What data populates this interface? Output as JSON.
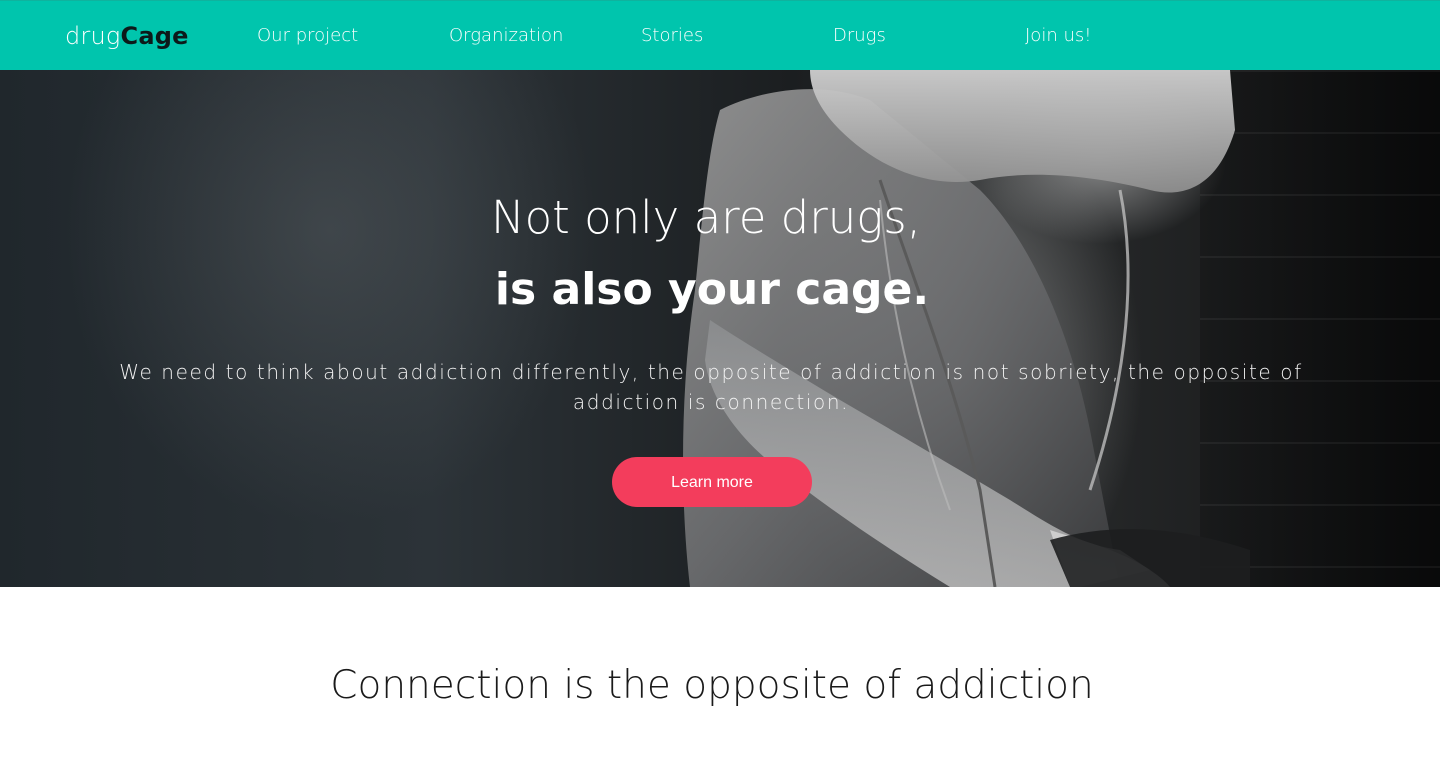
{
  "navbar": {
    "brand_light": "drug",
    "brand_bold": "Cage",
    "links": [
      "Our project",
      "Organization",
      "Stories",
      "Drugs",
      "Join us!"
    ],
    "background_color": "#00c5ad"
  },
  "hero": {
    "title_line1": "Not only are drugs,",
    "title_line2": "is also your cage.",
    "description": "We need to think about addiction differently, the opposite of addiction is not sobriety, the opposite of addiction is connection.",
    "button_label": "Learn more",
    "button_color": "#f33d5c",
    "image": "hooded-person-photo"
  },
  "section": {
    "title": "Connection is the opposite of addiction"
  }
}
